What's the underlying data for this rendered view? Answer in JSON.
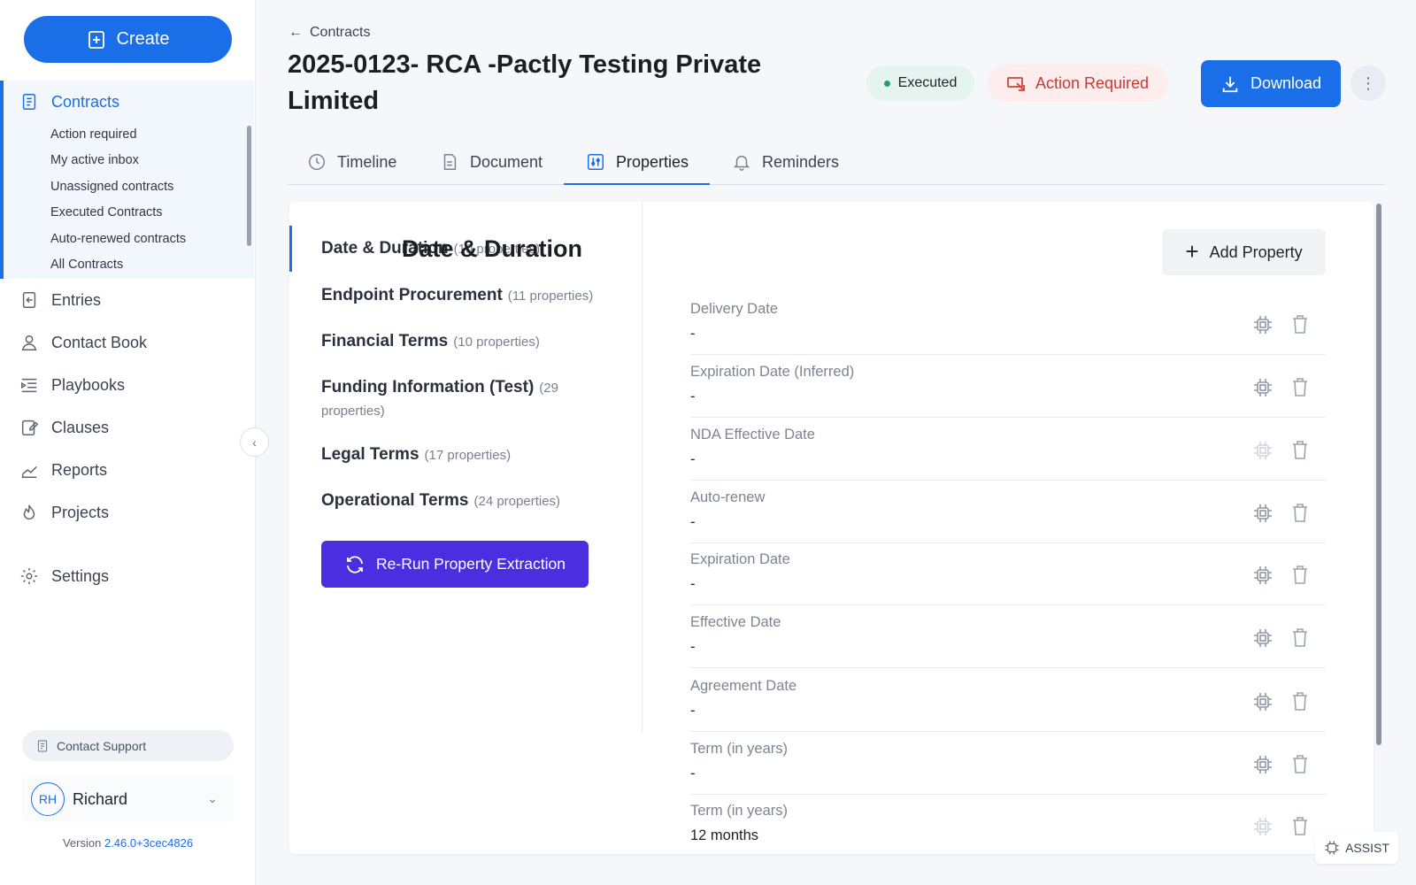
{
  "sidebar": {
    "create_label": "Create",
    "contracts_label": "Contracts",
    "sub_items": [
      "Action required",
      "My active inbox",
      "Unassigned contracts",
      "Executed Contracts",
      "Auto-renewed contracts",
      "All Contracts"
    ],
    "nav": {
      "entries": "Entries",
      "contact_book": "Contact Book",
      "playbooks": "Playbooks",
      "clauses": "Clauses",
      "reports": "Reports",
      "projects": "Projects",
      "settings": "Settings"
    },
    "contact_support": "Contact Support",
    "user": {
      "initials": "RH",
      "name": "Richard"
    },
    "version_label": "Version",
    "version_value": "2.46.0+3cec4826"
  },
  "header": {
    "back_label": "Contracts",
    "title": "2025-0123- RCA -Pactly Testing Private Limited",
    "status_badge": "Executed",
    "action_badge": "Action Required",
    "download_label": "Download"
  },
  "tabs": [
    "Timeline",
    "Document",
    "Properties",
    "Reminders"
  ],
  "categories": [
    {
      "name": "Date & Duration",
      "count": "(10 properties)"
    },
    {
      "name": "Endpoint Procurement",
      "count": "(11 properties)"
    },
    {
      "name": "Financial Terms",
      "count": "(10 properties)"
    },
    {
      "name": "Funding Information (Test)",
      "count": "(29 properties)"
    },
    {
      "name": "Legal Terms",
      "count": "(17 properties)"
    },
    {
      "name": "Operational Terms",
      "count": "(24 properties)"
    }
  ],
  "rerun_label": "Re-Run Property Extraction",
  "properties_panel": {
    "title": "Date & Duration",
    "add_label": "Add Property",
    "rows": [
      {
        "label": "Delivery Date",
        "value": "-"
      },
      {
        "label": "Expiration Date (Inferred)",
        "value": "-"
      },
      {
        "label": "NDA Effective Date",
        "value": "-"
      },
      {
        "label": "Auto-renew",
        "value": "-"
      },
      {
        "label": "Expiration Date",
        "value": "-"
      },
      {
        "label": "Effective Date",
        "value": "-"
      },
      {
        "label": "Agreement Date",
        "value": "-"
      },
      {
        "label": "Term (in years)",
        "value": "-"
      },
      {
        "label": "Term (in years)",
        "value": "12 months"
      }
    ]
  },
  "assist_label": "ASSIST",
  "colors": {
    "primary": "#1a6ee8",
    "rerun": "#4a2ee0",
    "executed_bg": "#e6f4ef",
    "action_bg": "#fdeeed",
    "action_text": "#c93a32"
  }
}
